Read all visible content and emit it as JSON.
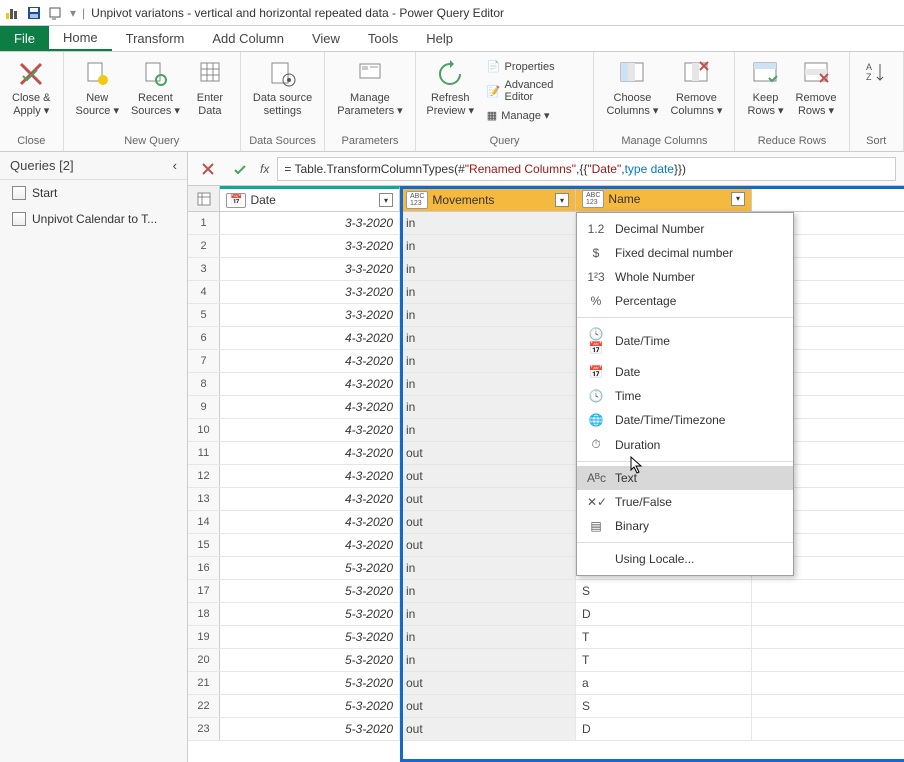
{
  "titlebar": {
    "title": "Unpivot variatons  - vertical and horizontal repeated data - Power Query Editor"
  },
  "menu": {
    "file": "File",
    "home": "Home",
    "transform": "Transform",
    "addcol": "Add Column",
    "view": "View",
    "tools": "Tools",
    "help": "Help"
  },
  "ribbon": {
    "close": {
      "close_apply": "Close &\nApply ▾",
      "group": "Close"
    },
    "newquery": {
      "newsource": "New\nSource ▾",
      "recent": "Recent\nSources ▾",
      "enterdata": "Enter\nData",
      "group": "New Query"
    },
    "datasources": {
      "settings": "Data source\nsettings",
      "group": "Data Sources"
    },
    "parameters": {
      "manage": "Manage\nParameters ▾",
      "group": "Parameters"
    },
    "query": {
      "refresh": "Refresh\nPreview ▾",
      "properties": "Properties",
      "advanced": "Advanced Editor",
      "manage": "Manage ▾",
      "group": "Query"
    },
    "managecols": {
      "choose": "Choose\nColumns ▾",
      "remove": "Remove\nColumns ▾",
      "group": "Manage Columns"
    },
    "reducerows": {
      "keep": "Keep\nRows ▾",
      "remove": "Remove\nRows ▾",
      "group": "Reduce Rows"
    },
    "sort": {
      "group": "Sort"
    }
  },
  "sidebar": {
    "header": "Queries [2]",
    "items": [
      {
        "label": "Start"
      },
      {
        "label": "Unpivot Calendar to T..."
      }
    ]
  },
  "formula": {
    "prefix": "= Table.TransformColumnTypes(#",
    "str1": "\"Renamed Columns\"",
    "mid": ",{{",
    "str2": "\"Date\"",
    "mid2": ", ",
    "typ": "type date",
    "suffix": "}})"
  },
  "grid": {
    "columns": {
      "date": "Date",
      "movements": "Movements",
      "name": "Name"
    },
    "type_icons": {
      "date": "📅",
      "any": "ABC\n123"
    },
    "rows": [
      {
        "n": "1",
        "date": "3-3-2020",
        "mov": "in",
        "name": ""
      },
      {
        "n": "2",
        "date": "3-3-2020",
        "mov": "in",
        "name": ""
      },
      {
        "n": "3",
        "date": "3-3-2020",
        "mov": "in",
        "name": ""
      },
      {
        "n": "4",
        "date": "3-3-2020",
        "mov": "in",
        "name": ""
      },
      {
        "n": "5",
        "date": "3-3-2020",
        "mov": "in",
        "name": ""
      },
      {
        "n": "6",
        "date": "4-3-2020",
        "mov": "in",
        "name": ""
      },
      {
        "n": "7",
        "date": "4-3-2020",
        "mov": "in",
        "name": ""
      },
      {
        "n": "8",
        "date": "4-3-2020",
        "mov": "in",
        "name": ""
      },
      {
        "n": "9",
        "date": "4-3-2020",
        "mov": "in",
        "name": ""
      },
      {
        "n": "10",
        "date": "4-3-2020",
        "mov": "in",
        "name": ""
      },
      {
        "n": "11",
        "date": "4-3-2020",
        "mov": "out",
        "name": ""
      },
      {
        "n": "12",
        "date": "4-3-2020",
        "mov": "out",
        "name": ""
      },
      {
        "n": "13",
        "date": "4-3-2020",
        "mov": "out",
        "name": ""
      },
      {
        "n": "14",
        "date": "4-3-2020",
        "mov": "out",
        "name": ""
      },
      {
        "n": "15",
        "date": "4-3-2020",
        "mov": "out",
        "name": ""
      },
      {
        "n": "16",
        "date": "5-3-2020",
        "mov": "in",
        "name": "a"
      },
      {
        "n": "17",
        "date": "5-3-2020",
        "mov": "in",
        "name": "S"
      },
      {
        "n": "18",
        "date": "5-3-2020",
        "mov": "in",
        "name": "D"
      },
      {
        "n": "19",
        "date": "5-3-2020",
        "mov": "in",
        "name": "T"
      },
      {
        "n": "20",
        "date": "5-3-2020",
        "mov": "in",
        "name": "T"
      },
      {
        "n": "21",
        "date": "5-3-2020",
        "mov": "out",
        "name": "a"
      },
      {
        "n": "22",
        "date": "5-3-2020",
        "mov": "out",
        "name": "S"
      },
      {
        "n": "23",
        "date": "5-3-2020",
        "mov": "out",
        "name": "D"
      }
    ]
  },
  "type_menu": {
    "items": [
      {
        "icon": "1.2",
        "label": "Decimal Number"
      },
      {
        "icon": "$",
        "label": "Fixed decimal number"
      },
      {
        "icon": "1²3",
        "label": "Whole Number"
      },
      {
        "icon": "%",
        "label": "Percentage"
      },
      {
        "sep": true
      },
      {
        "icon": "🕓📅",
        "label": "Date/Time"
      },
      {
        "icon": "📅",
        "label": "Date"
      },
      {
        "icon": "🕓",
        "label": "Time"
      },
      {
        "icon": "🌐",
        "label": "Date/Time/Timezone"
      },
      {
        "icon": "⏱",
        "label": "Duration"
      },
      {
        "sep": true
      },
      {
        "icon": "Aᴮc",
        "label": "Text",
        "hovered": true
      },
      {
        "icon": "✕✓",
        "label": "True/False"
      },
      {
        "icon": "▤",
        "label": "Binary"
      },
      {
        "sep": true
      },
      {
        "icon": "",
        "label": "Using Locale..."
      }
    ]
  }
}
